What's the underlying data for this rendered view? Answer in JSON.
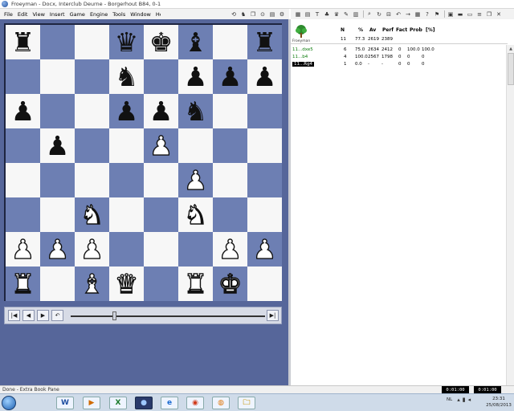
{
  "window": {
    "title": "Froeyman - Docx, Interclub Deurne - Borgerhout B84, 0-1"
  },
  "menu": [
    "File",
    "Edit",
    "View",
    "Insert",
    "Game",
    "Engine",
    "Tools",
    "Window",
    "Help"
  ],
  "board": {
    "ranks": [
      [
        "r",
        "",
        "",
        "q",
        "k",
        "b",
        "",
        "r"
      ],
      [
        "",
        "",
        "",
        "n",
        "",
        "p",
        "p",
        "p"
      ],
      [
        "p",
        "",
        "",
        "p",
        "p",
        "n",
        "",
        ""
      ],
      [
        "",
        "p",
        "",
        "",
        "P",
        "",
        "",
        ""
      ],
      [
        "",
        "",
        "",
        "",
        "",
        "P",
        "",
        ""
      ],
      [
        "",
        "",
        "N",
        "",
        "",
        "N",
        "",
        ""
      ],
      [
        "P",
        "P",
        "P",
        "",
        "",
        "",
        "P",
        "P"
      ],
      [
        "R",
        "",
        "B",
        "Q",
        "",
        "R",
        "K",
        ""
      ]
    ]
  },
  "book": {
    "tree_label": "Froeyman",
    "headers": [
      "N",
      "%",
      "Av",
      "Perf",
      "Fact",
      "Prob",
      "[%]"
    ],
    "summary": [
      "11",
      "77.3",
      "2619",
      "2389",
      "",
      "",
      ""
    ],
    "rows": [
      {
        "move": "11...dxe5",
        "n": "6",
        "pct": "75.0",
        "av": "2634",
        "perf": "2412",
        "fact": "0",
        "prob": "100.0",
        "book": "100.0"
      },
      {
        "move": "11...b4",
        "n": "4",
        "pct": "100.0",
        "av": "2567",
        "perf": "1798",
        "fact": "0",
        "prob": "0",
        "book": "0"
      },
      {
        "move": "11...Rg4",
        "n": "1",
        "pct": "0.0",
        "av": "-",
        "perf": "-",
        "fact": "0",
        "prob": "0",
        "book": "0"
      }
    ]
  },
  "status": {
    "text": "Done - Extra Book Pane",
    "clock_white": "0:01:00",
    "clock_black": "0:01:00"
  },
  "taskbar": {
    "apps": [
      "W",
      "▶",
      "X",
      "●",
      "e",
      "◉",
      "◍",
      "🗀"
    ],
    "lang": "NL",
    "time": "23:31",
    "date": "25/08/2013"
  }
}
